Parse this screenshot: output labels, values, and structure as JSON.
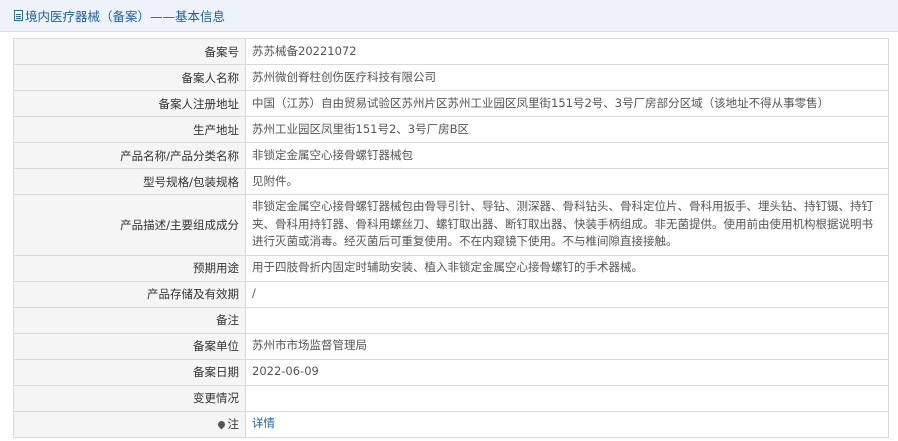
{
  "header": {
    "title": "境内医疗器械（备案）——基本信息",
    "icon": "document-icon"
  },
  "rows": [
    {
      "label": "备案号",
      "value": "苏苏械备20221072"
    },
    {
      "label": "备案人名称",
      "value": "苏州微创脊柱创伤医疗科技有限公司"
    },
    {
      "label": "备案人注册地址",
      "value": "中国（江苏）自由贸易试验区苏州片区苏州工业园区凤里街151号2号、3号厂房部分区域（该地址不得从事零售）"
    },
    {
      "label": "生产地址",
      "value": "苏州工业园区凤里街151号2、3号厂房B区"
    },
    {
      "label": "产品名称/产品分类名称",
      "value": "非锁定金属空心接骨螺钉器械包"
    },
    {
      "label": "型号规格/包装规格",
      "value": "见附件。"
    },
    {
      "label": "产品描述/主要组成成分",
      "value": "非锁定金属空心接骨螺钉器械包由骨导引针、导钻、测深器、骨科钻头、骨科定位片、骨科用扳手、埋头钻、持钉镊、持钉夹、骨科用持钉器、骨科用螺丝刀、螺钉取出器、断钉取出器、快装手柄组成。非无菌提供。使用前由使用机构根据说明书进行灭菌或消毒。经灭菌后可重复使用。不在内窥镜下使用。不与椎间隙直接接触。"
    },
    {
      "label": "预期用途",
      "value": "用于四肢骨折内固定时辅助安装、植入非锁定金属空心接骨螺钉的手术器械。"
    },
    {
      "label": "产品存储及有效期",
      "value": "/"
    },
    {
      "label": "备注",
      "value": ""
    },
    {
      "label": "备案单位",
      "value": "苏州市市场监督管理局"
    },
    {
      "label": "备案日期",
      "value": "2022-06-09"
    },
    {
      "label": "变更情况",
      "value": ""
    }
  ],
  "note_row": {
    "label": "注",
    "icon": "pin-icon",
    "link_text": "详情"
  },
  "colors": {
    "title": "#1d5fa6",
    "title_bg": "#eef3fa",
    "label_bg": "#f5f5f5",
    "border": "#d9d9d9",
    "link": "#1d5fa6"
  }
}
